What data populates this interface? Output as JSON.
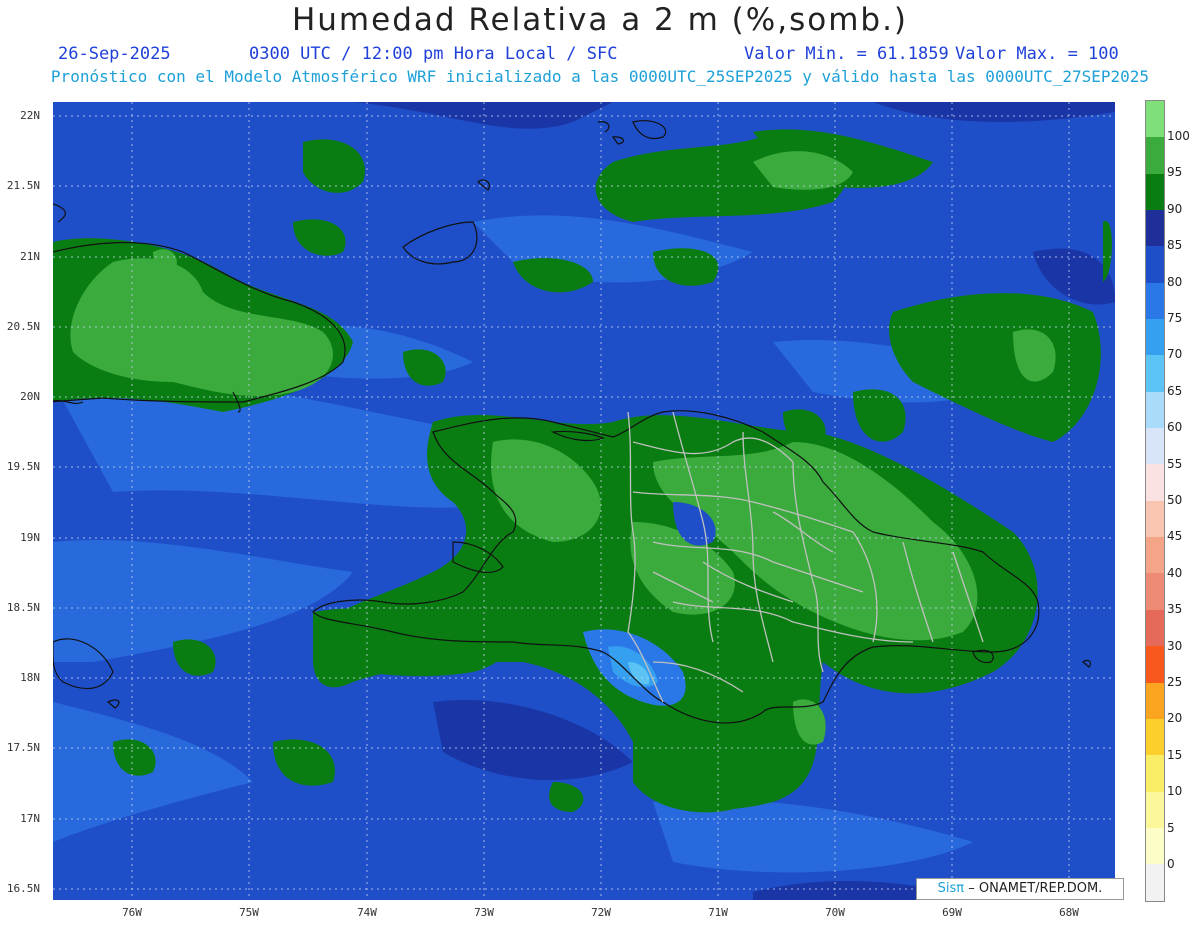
{
  "title": "Humedad Relativa a 2 m (%,somb.)",
  "header": {
    "date": "26-Sep-2025",
    "time": "0300 UTC / 12:00 pm Hora Local / SFC",
    "min": "Valor Min. = 61.1859",
    "max": "Valor Max. = 100",
    "subtitle": "Pronóstico con el Modelo Atmosférico WRF inicializado a las 0000UTC_25SEP2025 y válido hasta las  0000UTC_27SEP2025"
  },
  "lat_labels": [
    "22N",
    "21.5N",
    "21N",
    "20.5N",
    "20N",
    "19.5N",
    "19N",
    "18.5N",
    "18N",
    "17.5N",
    "17N",
    "16.5N"
  ],
  "lon_labels": [
    "76W",
    "75W",
    "74W",
    "73W",
    "72W",
    "71W",
    "70W",
    "69W",
    "68W"
  ],
  "colorbar": {
    "labels": [
      "100",
      "95",
      "90",
      "85",
      "80",
      "75",
      "70",
      "65",
      "60",
      "55",
      "50",
      "45",
      "40",
      "35",
      "30",
      "25",
      "20",
      "15",
      "10",
      "5",
      "0"
    ],
    "colors": [
      "#7fe07a",
      "#3aab3c",
      "#0a7d12",
      "#1f2f9a",
      "#1f4fc8",
      "#2a78e8",
      "#36a0f0",
      "#5cc4f5",
      "#a8dcfa",
      "#d8e4f8",
      "#fbe2e2",
      "#f8c6b0",
      "#f4a588",
      "#ec8a74",
      "#e66a5a",
      "#f8581c",
      "#fba420",
      "#fccf2c",
      "#f8ed64",
      "#fbf79a",
      "#fdfdc8",
      "#f2f2f2"
    ]
  },
  "credit": {
    "brand": "Sisπ",
    "text": "– ONAMET/REP.DOM."
  }
}
